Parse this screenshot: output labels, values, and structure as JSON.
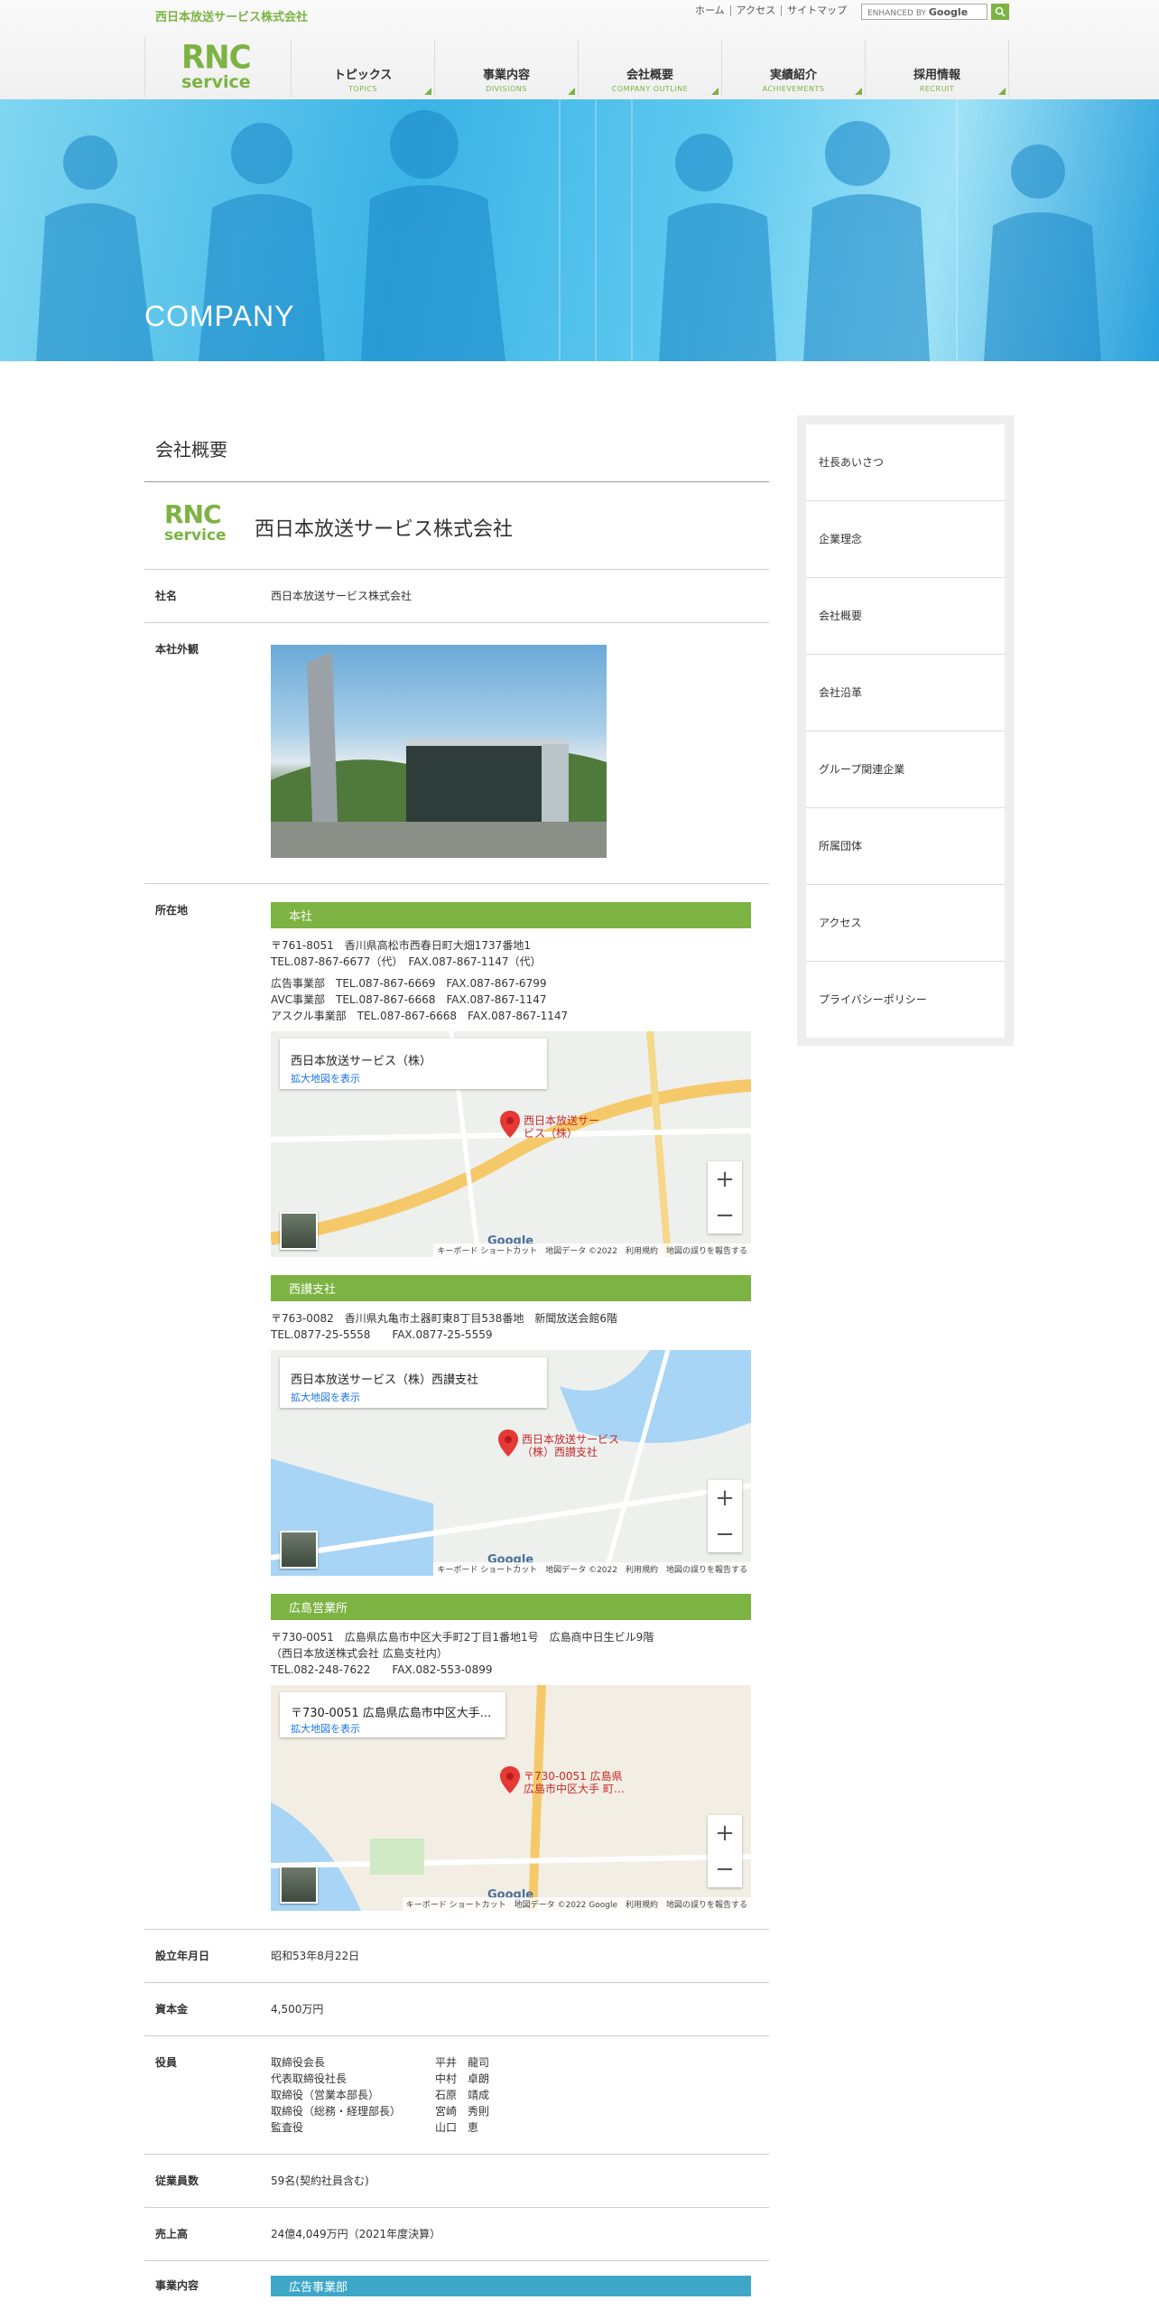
{
  "header": {
    "company_name": "西日本放送サービス株式会社",
    "top_links": [
      "ホーム",
      "アクセス",
      "サイトマップ"
    ],
    "search_placeholder": "ENHANCED BY",
    "search_brand": "Google",
    "logo_line1": "RNC",
    "logo_line2": "service"
  },
  "nav": [
    {
      "jp": "トピックス",
      "en": "TOPICS"
    },
    {
      "jp": "事業内容",
      "en": "DIVISIONS"
    },
    {
      "jp": "会社概要",
      "en": "COMPANY OUTLINE"
    },
    {
      "jp": "実績紹介",
      "en": "ACHIEVEMENTS"
    },
    {
      "jp": "採用情報",
      "en": "RECRUIT"
    }
  ],
  "hero": {
    "title": "COMPANY"
  },
  "main": {
    "heading": "会社概要",
    "brand_logo_a": "RNC",
    "brand_logo_b": "service",
    "brand_name": "西日本放送サービス株式会社",
    "rows": {
      "name_label": "社名",
      "name_value": "西日本放送サービス株式会社",
      "exterior_label": "本社外観",
      "location_label": "所在地",
      "founded_label": "設立年月日",
      "founded_value": "昭和53年8月22日",
      "capital_label": "資本金",
      "capital_value": "4,500万円",
      "officers_label": "役員",
      "employees_label": "従業員数",
      "employees_value": "59名(契約社員含む)",
      "sales_label": "売上高",
      "sales_value": "24億4,049万円（2021年度決算）",
      "business_label": "事業内容",
      "business_first": "広告事業部"
    },
    "hq": {
      "title": "本社",
      "line1": "〒761-8051　香川県高松市西春日町大畑1737番地1",
      "line2": "TEL.087-867-6677（代）　FAX.087-867-1147（代）",
      "line3": "広告事業部　TEL.087-867-6669　FAX.087-867-6799",
      "line4": "AVC事業部　TEL.087-867-6668　FAX.087-867-1147",
      "line5": "アスクル事業部　TEL.087-867-6668　FAX.087-867-1147",
      "map_title": "西日本放送サービス（株）",
      "map_link": "拡大地図を表示",
      "pin_label": "西日本放送サービス（株）"
    },
    "west": {
      "title": "西讃支社",
      "line1": "〒763-0082　香川県丸亀市土器町東8丁目538番地　新聞放送会館6階",
      "line2": "TEL.0877-25-5558　　FAX.0877-25-5559",
      "map_title": "西日本放送サービス（株）西讃支社",
      "map_link": "拡大地図を表示",
      "pin_label": "西日本放送サービス（株）西讃支社"
    },
    "hiroshima": {
      "title": "広島営業所",
      "line1": "〒730-0051　広島県広島市中区大手町2丁目1番地1号　広島商中日生ビル9階",
      "line2": "（西日本放送株式会社 広島支社内）",
      "line3": "TEL.082-248-7622　　FAX.082-553-0899",
      "map_title": "〒730-0051 広島県広島市中区大手...",
      "map_link": "拡大地図を表示",
      "pin_label": "〒730-0051 広島県広島市中区大手 町…"
    },
    "map_attr_1": "キーボード ショートカット　地図データ ©2022　利用規約　地図の誤りを報告する",
    "map_attr_3": "キーボード ショートカット　地図データ ©2022 Google　利用規約　地図の誤りを報告する",
    "google_logo": "Google",
    "officers": [
      {
        "role": "取締役会長",
        "name": "平井　龍司"
      },
      {
        "role": "代表取締役社長",
        "name": "中村　卓朗"
      },
      {
        "role": "取締役（営業本部長）",
        "name": "石原　靖成"
      },
      {
        "role": "取締役（総務・経理部長）",
        "name": "宮崎　秀則"
      },
      {
        "role": "監査役",
        "name": "山口　恵"
      }
    ]
  },
  "sidebar": [
    "社長あいさつ",
    "企業理念",
    "会社概要",
    "会社沿革",
    "グループ関連企業",
    "所属団体",
    "アクセス",
    "プライバシーポリシー"
  ]
}
